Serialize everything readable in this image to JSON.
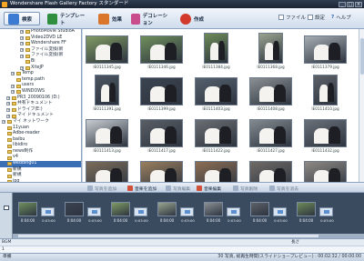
{
  "window": {
    "title": "Wondershare Flash Gallery Factory スタンダード",
    "minimize": "_",
    "maximize": "□",
    "close": "×"
  },
  "toolbar": {
    "items": [
      {
        "label": "検索",
        "icon": "search-icon",
        "color": "#3d7ad1"
      },
      {
        "label": "テンプレート",
        "icon": "template-icon",
        "color": "#2f8f3f"
      },
      {
        "label": "効果",
        "icon": "effect-icon",
        "color": "#d9762b"
      },
      {
        "label": "デコレーション",
        "icon": "decoration-icon",
        "color": "#c94d8c"
      },
      {
        "label": "作成",
        "icon": "create-icon",
        "color": "#d23a2b"
      }
    ],
    "right": {
      "file": "ファイル",
      "settings": "設定",
      "help": "ヘルプ"
    }
  },
  "folder_tree": [
    {
      "label": "PhotoMovie StudioA",
      "indent": 4,
      "expander": "+"
    },
    {
      "label": "Video2DVD LE",
      "indent": 4,
      "expander": "+"
    },
    {
      "label": "Wondershare FF",
      "indent": 4,
      "expander": "+"
    },
    {
      "label": "ファイル変換(新",
      "indent": 4,
      "expander": "+"
    },
    {
      "label": "ファイル変換(新",
      "indent": 4,
      "expander": "+"
    },
    {
      "label": "Bi",
      "indent": 4,
      "expander": ""
    },
    {
      "label": "XiteJP",
      "indent": 4,
      "expander": "+"
    },
    {
      "label": "Temp",
      "indent": 2,
      "expander": "+"
    },
    {
      "label": "temp.path",
      "indent": 2,
      "expander": ""
    },
    {
      "label": "users",
      "indent": 2,
      "expander": "+"
    },
    {
      "label": "WINDOWS",
      "indent": 2,
      "expander": "+"
    },
    {
      "label": "PR3_20090106 (D:)",
      "indent": 1,
      "expander": "+"
    },
    {
      "label": "共有ドキュメント",
      "indent": 1,
      "expander": "+"
    },
    {
      "label": "ドライブ(E:)",
      "indent": 1,
      "expander": "+"
    },
    {
      "label": "マイ ドキュメント",
      "indent": 1,
      "expander": "+"
    },
    {
      "label": "マイ ネットワーク",
      "indent": 0,
      "expander": "+"
    },
    {
      "label": "11yuan",
      "indent": 0,
      "expander": ""
    },
    {
      "label": "Adbe-reader",
      "indent": 0,
      "expander": ""
    },
    {
      "label": "baibu",
      "indent": 0,
      "expander": ""
    },
    {
      "label": "libidiro",
      "indent": 0,
      "expander": ""
    },
    {
      "label": "news制作",
      "indent": 0,
      "expander": ""
    },
    {
      "label": "v4",
      "indent": 0,
      "expander": ""
    },
    {
      "label": "wedding01",
      "indent": 0,
      "expander": "",
      "selected": true
    },
    {
      "label": "新規",
      "indent": 0,
      "expander": ""
    },
    {
      "label": "新規",
      "indent": 0,
      "expander": ""
    },
    {
      "label": "jpg",
      "indent": 0,
      "expander": ""
    }
  ],
  "thumbnails": [
    {
      "name": "IE0111345.jpg",
      "orient": "land",
      "tone": "#7f9a63"
    },
    {
      "name": "IE0111346.jpg",
      "orient": "land",
      "tone": "#6f8f5c"
    },
    {
      "name": "IE0111384.jpg",
      "orient": "port",
      "tone": "#6d8a58"
    },
    {
      "name": "IE0111368.jpg",
      "orient": "port",
      "tone": "#9aa38f"
    },
    {
      "name": "IE0111379.jpg",
      "orient": "land",
      "tone": "#a6aeb3"
    },
    {
      "name": "IE0111391.jpg",
      "orient": "port",
      "tone": "#4b5460"
    },
    {
      "name": "IE0111399.jpg",
      "orient": "land",
      "tone": "#3b4350"
    },
    {
      "name": "IE0111403.jpg",
      "orient": "land",
      "tone": "#55606e"
    },
    {
      "name": "IE0111408.jpg",
      "orient": "land",
      "tone": "#8a8f93"
    },
    {
      "name": "IE0111410.jpg",
      "orient": "port",
      "tone": "#5d6168"
    },
    {
      "name": "IE0111413.jpg",
      "orient": "land",
      "tone": "#c8cdd2"
    },
    {
      "name": "IE0111417.jpg",
      "orient": "land",
      "tone": "#5a5f66"
    },
    {
      "name": "IE0111422.jpg",
      "orient": "land",
      "tone": "#6b6e72"
    },
    {
      "name": "IE0111427.jpg",
      "orient": "land",
      "tone": "#838a90"
    },
    {
      "name": "IE0111432.jpg",
      "orient": "land",
      "tone": "#6a7078"
    },
    {
      "name": "",
      "orient": "land",
      "tone": "#7c6d5a"
    },
    {
      "name": "",
      "orient": "land",
      "tone": "#9a7f5e"
    },
    {
      "name": "",
      "orient": "land",
      "tone": "#8d6e53"
    },
    {
      "name": "",
      "orient": "land",
      "tone": "#6f6a66"
    },
    {
      "name": "",
      "orient": "land",
      "tone": "#8f8a84"
    }
  ],
  "midbar": [
    {
      "label": "写真を追加",
      "enabled": false
    },
    {
      "label": "音楽を追加",
      "enabled": true
    },
    {
      "label": "写真編集",
      "enabled": false
    },
    {
      "label": "音楽編集",
      "enabled": true
    },
    {
      "label": "写真削除",
      "enabled": false
    },
    {
      "label": "写真を消去",
      "enabled": false
    }
  ],
  "timeline": {
    "slides": [
      {
        "duration": "0:04:00",
        "tone": "#6f8f5c"
      },
      {
        "duration": "0:04:00",
        "tone": "#3b4350"
      },
      {
        "duration": "0:04:00",
        "tone": "#7f9a63"
      },
      {
        "duration": "0:04:00",
        "tone": "#9aa38f"
      },
      {
        "duration": "0:04:00",
        "tone": "#8a8f93"
      },
      {
        "duration": "0:04:00",
        "tone": "#5d6168"
      },
      {
        "duration": "0:04:00",
        "tone": "#6d8a58"
      }
    ],
    "transitions": [
      "0:03:00",
      "0:03:00",
      "0:03:00",
      "0:03:00",
      "0:03:00",
      "0:03:00",
      "0:03:00"
    ]
  },
  "bgm": {
    "label": "BGM",
    "column": "長さ",
    "row2": "1"
  },
  "status": {
    "left": "準備",
    "right": "30 写真, 総再生時間(スライドショープレビュー) : 00:02:32 / 00:00:00"
  }
}
